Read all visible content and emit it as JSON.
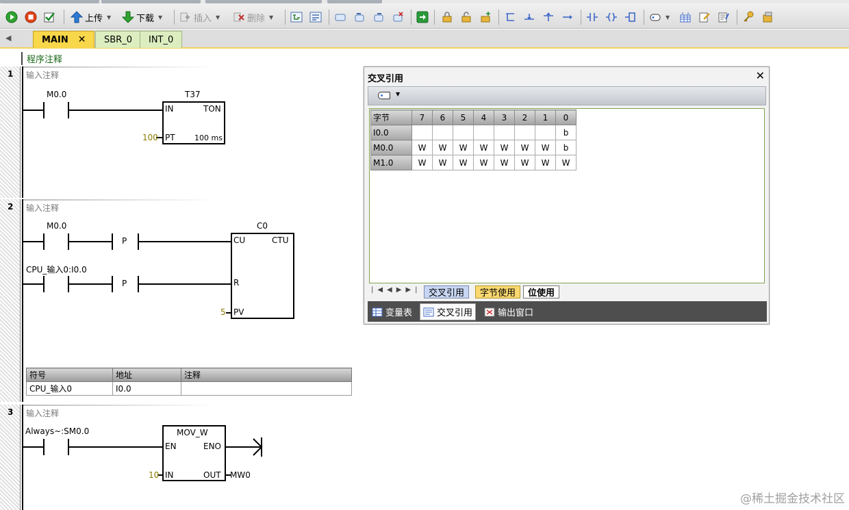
{
  "toolbar": {
    "upload_label": "上传",
    "download_label": "下载",
    "insert_label": "插入",
    "delete_label": "删除"
  },
  "tabs": [
    {
      "label": "MAIN",
      "close": "✕"
    },
    {
      "label": "SBR_0"
    },
    {
      "label": "INT_0"
    }
  ],
  "editor": {
    "program_comment": "程序注释",
    "networks": [
      {
        "number": "1",
        "comment": "输入注释",
        "contact": "M0.0",
        "box_title": "T37",
        "box_type": "TON",
        "in_label": "IN",
        "pt_label": "PT",
        "pt_value": "100",
        "time_base": "100 ms"
      },
      {
        "number": "2",
        "comment": "输入注释",
        "contact1": "M0.0",
        "contact2": "CPU_输入0:I0.0",
        "edge_label": "P",
        "box_title": "C0",
        "box_type": "CTU",
        "cu_label": "CU",
        "r_label": "R",
        "pv_label": "PV",
        "pv_value": "5",
        "symbol_table": {
          "headers": [
            "符号",
            "地址",
            "注释"
          ],
          "rows": [
            [
              "CPU_输入0",
              "I0.0",
              ""
            ]
          ]
        }
      },
      {
        "number": "3",
        "comment": "输入注释",
        "contact": "Always~:SM0.0",
        "box_title": "MOV_W",
        "en_label": "EN",
        "eno_label": "ENO",
        "in_label": "IN",
        "out_label": "OUT",
        "in_value": "10",
        "out_value": "MW0"
      }
    ]
  },
  "cross_ref": {
    "title": "交叉引用",
    "close": "✕",
    "columns": [
      "字节",
      "7",
      "6",
      "5",
      "4",
      "3",
      "2",
      "1",
      "0"
    ],
    "rows": [
      {
        "label": "I0.0",
        "cells": [
          "",
          "",
          "",
          "",
          "",
          "",
          "",
          "b"
        ]
      },
      {
        "label": "M0.0",
        "cells": [
          "W",
          "W",
          "W",
          "W",
          "W",
          "W",
          "W",
          "b"
        ]
      },
      {
        "label": "M1.0",
        "cells": [
          "W",
          "W",
          "W",
          "W",
          "W",
          "W",
          "W",
          "W"
        ]
      }
    ],
    "sheet_tabs": [
      "交叉引用",
      "字节使用",
      "位使用"
    ],
    "bottom_tabs": [
      "变量表",
      "交叉引用",
      "输出窗口"
    ]
  },
  "watermark": "@稀土掘金技术社区"
}
